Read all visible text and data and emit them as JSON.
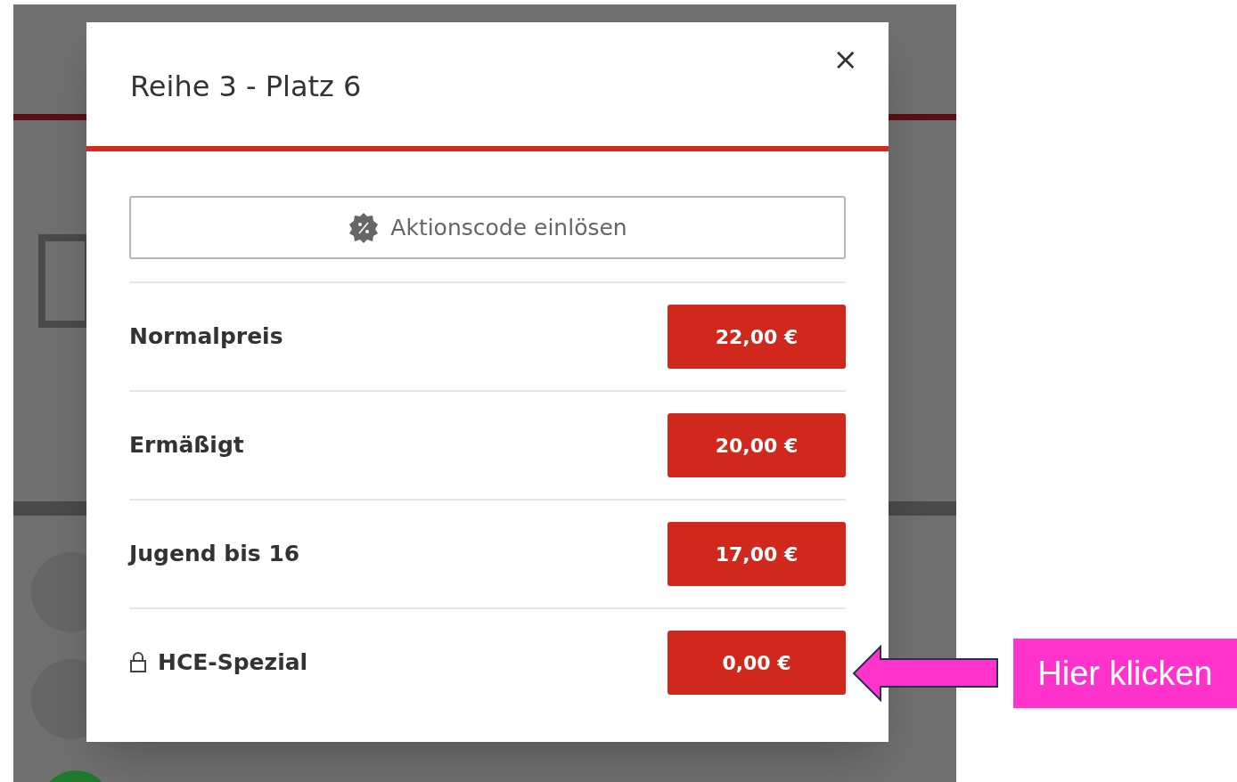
{
  "modal": {
    "title": "Reihe 3 - Platz 6",
    "close_label": "×",
    "promo_button": "Aktionscode einlösen",
    "prices": [
      {
        "label": "Normalpreis",
        "price": "22,00 €",
        "locked": false
      },
      {
        "label": "Ermäßigt",
        "price": "20,00 €",
        "locked": false
      },
      {
        "label": "Jugend bis 16",
        "price": "17,00 €",
        "locked": false
      },
      {
        "label": "HCE-Spezial",
        "price": "0,00 €",
        "locked": true
      }
    ]
  },
  "annotation": {
    "label": "Hier klicken"
  }
}
